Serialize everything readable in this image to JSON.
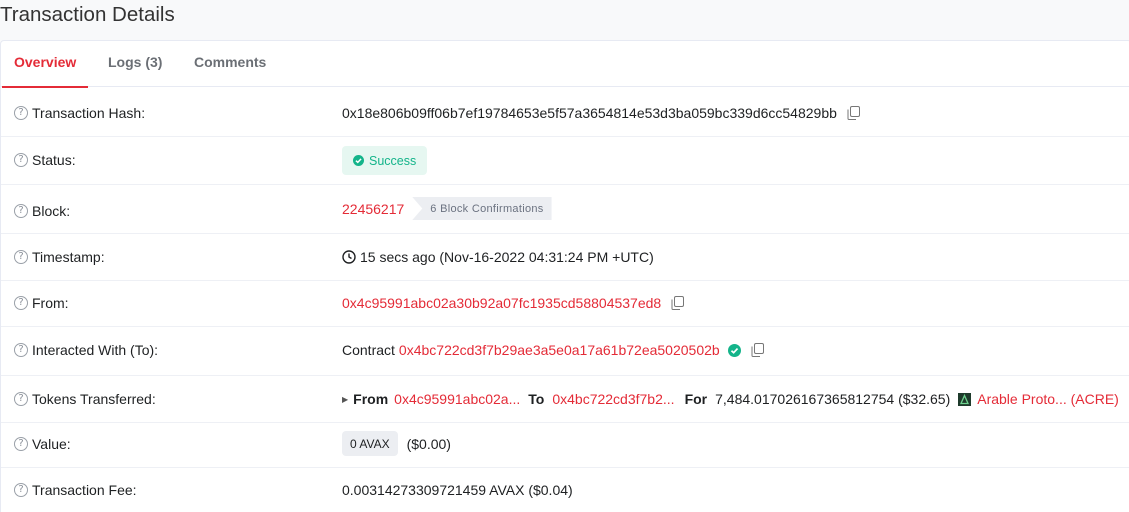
{
  "page": {
    "title": "Transaction Details"
  },
  "tabs": [
    {
      "label": "Overview",
      "active": true
    },
    {
      "label": "Logs (3)",
      "active": false
    },
    {
      "label": "Comments",
      "active": false
    }
  ],
  "rows": {
    "hash": {
      "label": "Transaction Hash:",
      "value": "0x18e806b09ff06b7ef19784653e5f57a3654814e53d3ba059bc339d6cc54829bb"
    },
    "status": {
      "label": "Status:",
      "value": "Success"
    },
    "block": {
      "label": "Block:",
      "value": "22456217",
      "confirmations": "6 Block Confirmations"
    },
    "timestamp": {
      "label": "Timestamp:",
      "value": "15 secs ago (Nov-16-2022 04:31:24 PM +UTC)"
    },
    "from": {
      "label": "From:",
      "value": "0x4c95991abc02a30b92a07fc1935cd58804537ed8"
    },
    "to": {
      "label": "Interacted With (To):",
      "prefix": "Contract",
      "value": "0x4bc722cd3f7b29ae3a5e0a17a61b72ea5020502b"
    },
    "tokens": {
      "label": "Tokens Transferred:",
      "from_label": "From",
      "from_value": "0x4c95991abc02a...",
      "to_label": "To",
      "to_value": "0x4bc722cd3f7b2...",
      "for_label": "For",
      "amount": "7,484.017026167365812754 ($32.65)",
      "token": "Arable Proto... (ACRE)"
    },
    "value": {
      "label": "Value:",
      "badge": "0 AVAX",
      "usd": "($0.00)"
    },
    "fee": {
      "label": "Transaction Fee:",
      "value": "0.00314273309721459 AVAX ($0.04)"
    }
  },
  "colors": {
    "accent": "#e42b37",
    "success": "#14b48a",
    "success_bg": "#e6f7f1"
  }
}
